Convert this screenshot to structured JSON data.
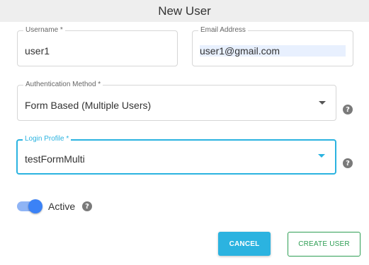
{
  "dialog": {
    "title": "New User"
  },
  "form": {
    "username": {
      "label": "Username *",
      "value": "user1"
    },
    "email": {
      "label": "Email Address",
      "value": "user1@gmail.com"
    },
    "auth_method": {
      "label": "Authentication Method *",
      "value": "Form Based (Multiple Users)"
    },
    "login_profile": {
      "label": "Login Profile *",
      "value": "testFormMulti"
    },
    "active": {
      "label": "Active",
      "checked": true
    }
  },
  "buttons": {
    "cancel": "CANCEL",
    "create": "CREATE USER"
  },
  "icons": {
    "help": "?"
  },
  "colors": {
    "accent": "#2bb3e0",
    "create": "#2e9e54",
    "toggle": "#3b82f6"
  }
}
